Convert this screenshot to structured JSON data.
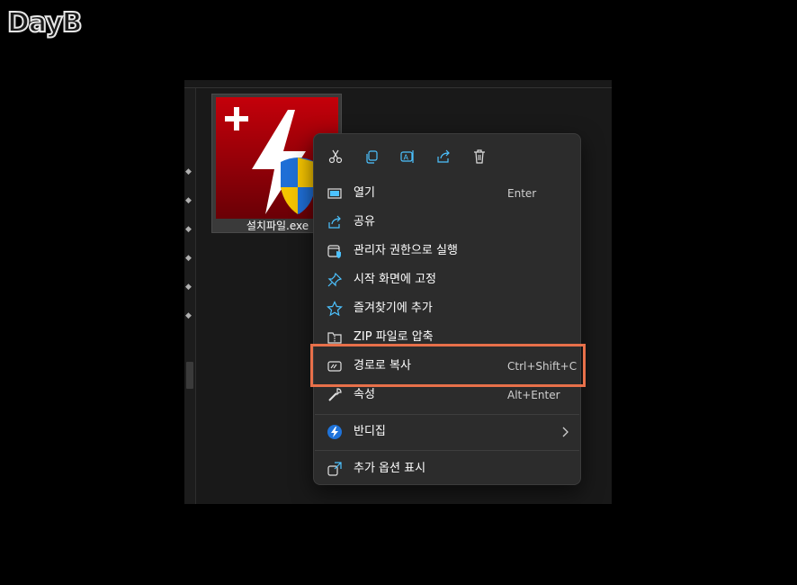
{
  "logo": {
    "text": "DayB"
  },
  "file": {
    "name": "설치파일.exe"
  },
  "quick_actions": [
    "cut-icon",
    "copy-icon",
    "rename-icon",
    "share-icon",
    "delete-icon"
  ],
  "menu": {
    "items": [
      {
        "label": "열기",
        "shortcut": "Enter"
      },
      {
        "label": "공유",
        "shortcut": ""
      },
      {
        "label": "관리자 권한으로 실행",
        "shortcut": ""
      },
      {
        "label": "시작 화면에 고정",
        "shortcut": ""
      },
      {
        "label": "즐겨찾기에 추가",
        "shortcut": ""
      },
      {
        "label": "ZIP 파일로 압축",
        "shortcut": ""
      },
      {
        "label": "경로로 복사",
        "shortcut": "Ctrl+Shift+C"
      },
      {
        "label": "속성",
        "shortcut": "Alt+Enter"
      },
      {
        "label": "반디집",
        "shortcut": ""
      },
      {
        "label": "추가 옵션 표시",
        "shortcut": ""
      }
    ]
  },
  "colors": {
    "highlight": "#e8704a",
    "accent": "#4cc2ff",
    "menu_bg": "#2c2c2c"
  }
}
